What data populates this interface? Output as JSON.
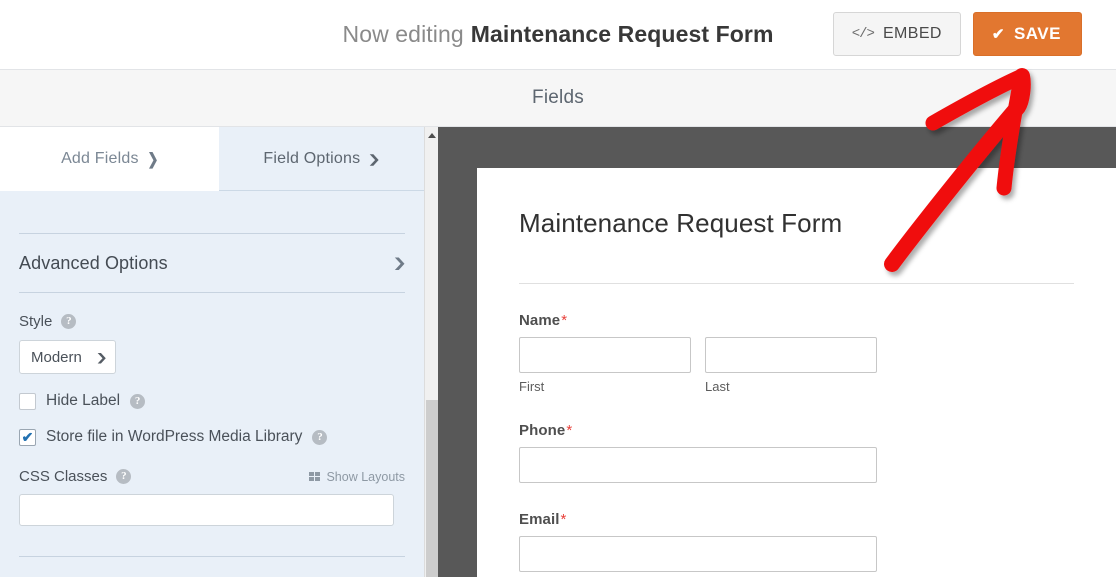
{
  "topbar": {
    "now_editing_prefix": "Now editing",
    "form_name": "Maintenance Request Form",
    "embed_button": "EMBED",
    "embed_icon": "</>",
    "save_button": "SAVE",
    "save_icon": "✔",
    "save_color": "#e27730"
  },
  "fieldsbar": {
    "label": "Fields"
  },
  "sidebar": {
    "tabs": [
      {
        "label": "Add Fields",
        "icon": "chevron-right",
        "active": false
      },
      {
        "label": "Field Options",
        "icon": "chevron-down",
        "active": true
      }
    ],
    "section": {
      "title": "Advanced Options",
      "icon": "chevron-down"
    },
    "style": {
      "label": "Style",
      "help": "?",
      "selected": "Modern",
      "icon": "chevron-down"
    },
    "hide_label": {
      "label": "Hide Label",
      "help": "?",
      "checked": false
    },
    "store_file": {
      "label": "Store file in WordPress Media Library",
      "help": "?",
      "checked": true,
      "check_glyph": "✔",
      "check_color": "#2271b1"
    },
    "css_classes": {
      "label": "CSS Classes",
      "help": "?",
      "value": "",
      "show_layouts_label": "Show Layouts"
    }
  },
  "preview": {
    "form_title": "Maintenance Request Form",
    "fields": [
      {
        "label": "Name",
        "required": "*",
        "layout": "two-column",
        "sublabels": [
          "First",
          "Last"
        ],
        "values": [
          "",
          ""
        ]
      },
      {
        "label": "Phone",
        "required": "*",
        "layout": "single",
        "sublabels": [],
        "values": [
          ""
        ]
      },
      {
        "label": "Email",
        "required": "*",
        "layout": "single",
        "sublabels": [],
        "values": [
          ""
        ]
      }
    ]
  },
  "annotation": {
    "type": "hand-drawn-arrow",
    "color": "#f01010",
    "points_to": "save-button"
  }
}
